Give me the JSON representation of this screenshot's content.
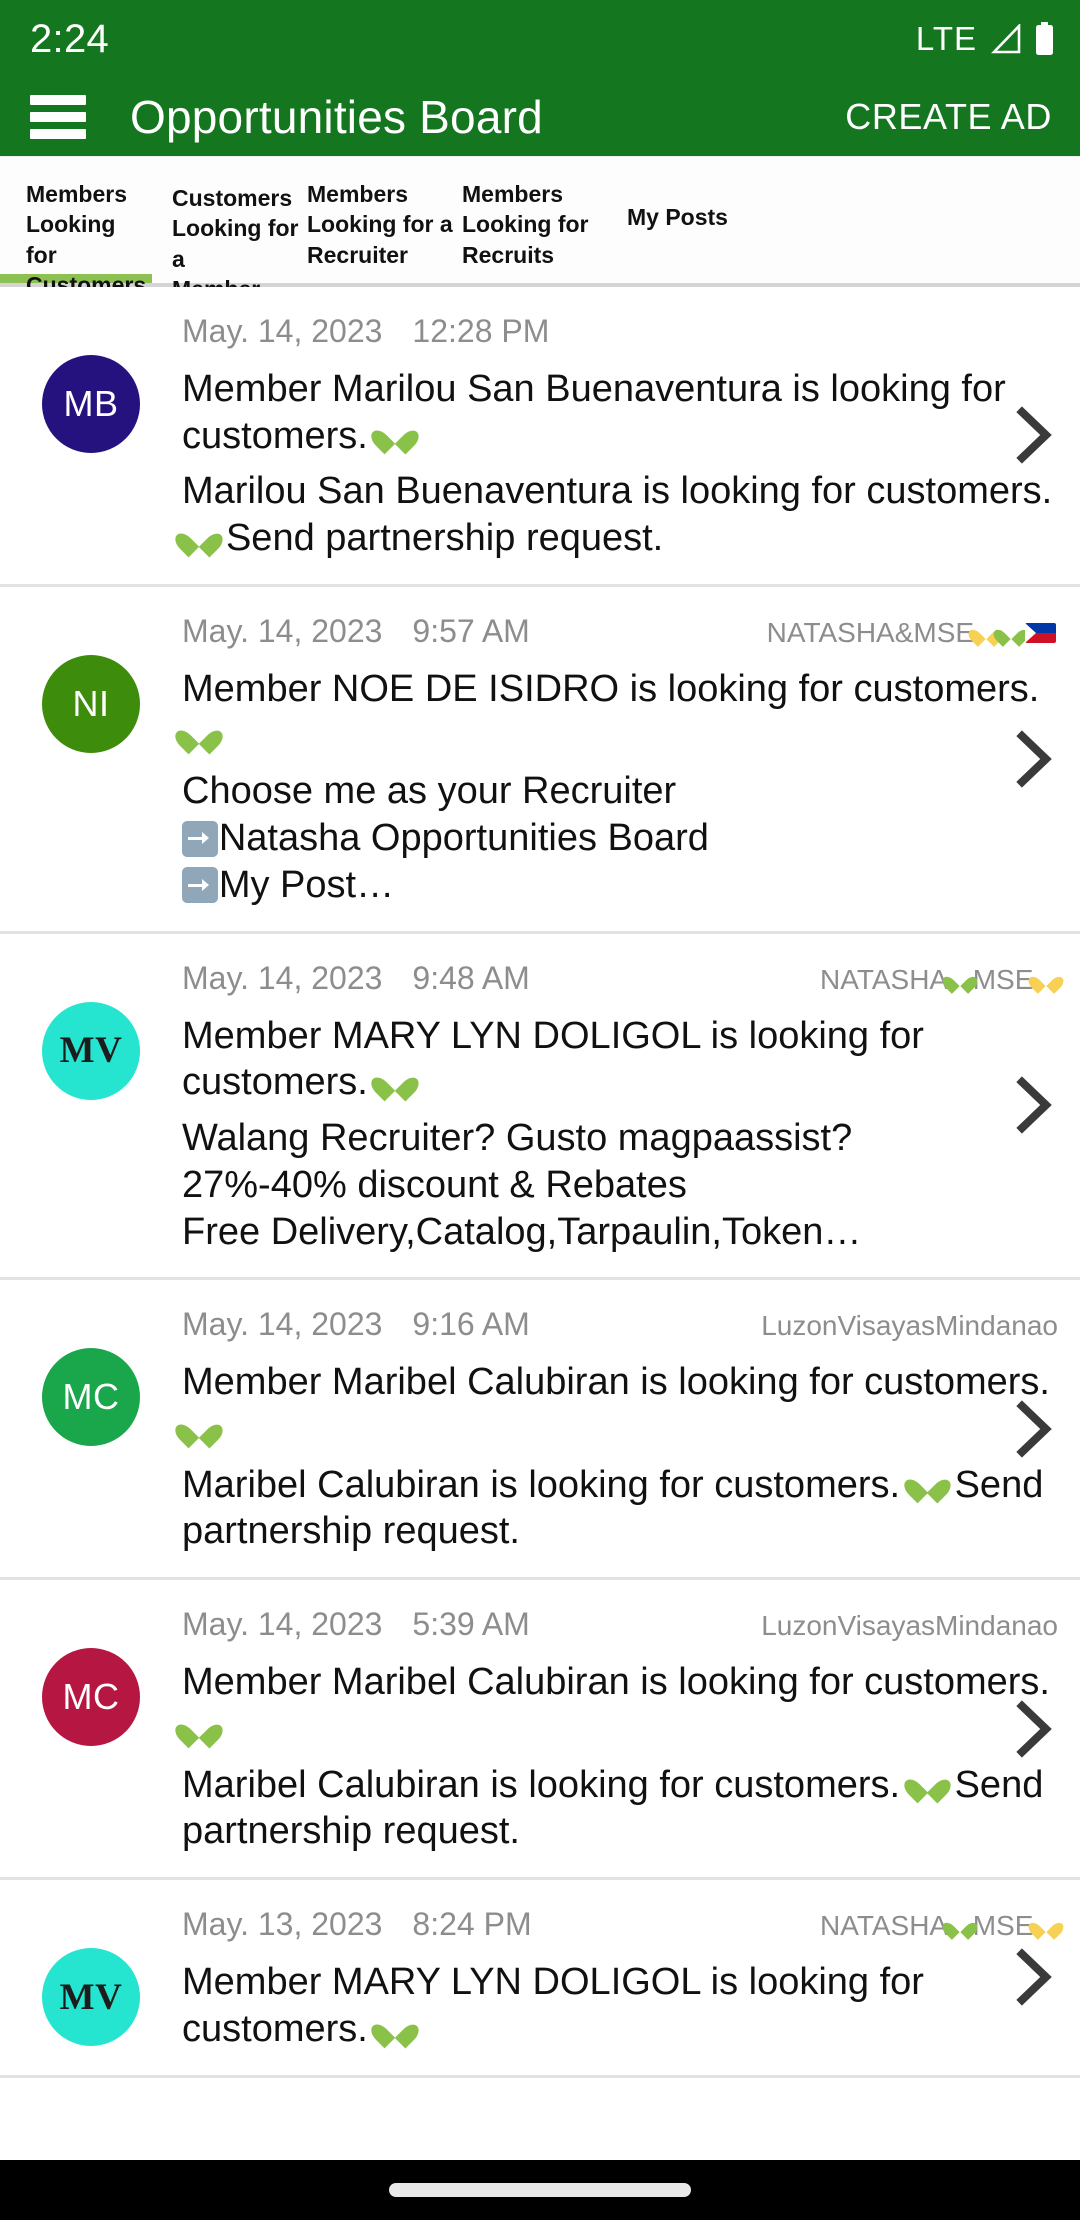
{
  "status_bar": {
    "time": "2:24",
    "network": "LTE",
    "signal_icon": "signal-triangle-icon",
    "battery_icon": "battery-full-icon"
  },
  "app_bar": {
    "menu_icon": "hamburger-menu-icon",
    "title": "Opportunities Board",
    "action_label": "CREATE AD",
    "background_color": "#14771f"
  },
  "tabs": {
    "active_index": 0,
    "indicator_color": "#8cc152",
    "items": [
      {
        "lines": [
          "Members",
          "Looking for",
          "Customers"
        ]
      },
      {
        "lines": [
          "Customers",
          "Looking for a",
          "Member"
        ]
      },
      {
        "lines": [
          "Members",
          "Looking for a",
          "Recruiter"
        ]
      },
      {
        "lines": [
          "Members",
          "Looking for",
          "Recruits"
        ]
      },
      {
        "lines": [
          "My Posts"
        ]
      }
    ]
  },
  "posts": [
    {
      "avatar_initials": "MB",
      "avatar_color": "#26127e",
      "avatar_font": "sans",
      "date": "May. 14, 2023",
      "time": "12:28 PM",
      "badge_text": "",
      "badge_emojis": [],
      "title_pre": "Member Marilou San Buenaventura is looking for customers. ",
      "title_heart": "green",
      "body_segments": [
        {
          "text": "Marilou San Buenaventura is looking for customers. "
        },
        {
          "heart": "green"
        },
        {
          "text": " Send partnership request."
        }
      ],
      "chevron_icon": "chevron-right-icon"
    },
    {
      "avatar_initials": "NI",
      "avatar_color": "#3d8c0c",
      "avatar_font": "sans",
      "date": "May. 14, 2023",
      "time": "9:57 AM",
      "badge_text": "NATASHA&MSE",
      "badge_emojis": [
        "yellow-heart",
        "green-heart",
        "philippines-flag"
      ],
      "title_pre": "Member NOE DE ISIDRO is looking for customers. ",
      "title_heart": "green",
      "body_segments": [
        {
          "text": "Choose me as your Recruiter\n"
        },
        {
          "arrow": true
        },
        {
          "text": "Natasha Opportunities Board\n"
        },
        {
          "arrow": true
        },
        {
          "text": "My Post…"
        }
      ],
      "chevron_icon": "chevron-right-icon"
    },
    {
      "avatar_initials": "MV",
      "avatar_color": "#25e4d0",
      "avatar_font": "serif",
      "date": "May. 14, 2023",
      "time": "9:48 AM",
      "badge_text": "NATASHA",
      "badge_text_2": "MSE",
      "badge_emojis": [
        "green-heart",
        "yellow-heart"
      ],
      "title_pre": "Member MARY LYN DOLIGOL is looking for customers. ",
      "title_heart": "green",
      "body_segments": [
        {
          "text": "Walang Recruiter? Gusto magpaassist?\n27%-40% discount & Rebates\nFree Delivery,Catalog,Tarpaulin,Token…"
        }
      ],
      "chevron_icon": "chevron-right-icon"
    },
    {
      "avatar_initials": "MC",
      "avatar_color": "#1aa64b",
      "avatar_font": "sans",
      "date": "May. 14, 2023",
      "time": "9:16 AM",
      "badge_text": "LuzonVisayasMindanao",
      "badge_emojis": [],
      "title_pre": "Member Maribel Calubiran is looking for customers. ",
      "title_heart": "green",
      "body_segments": [
        {
          "text": "Maribel Calubiran is looking for customers. "
        },
        {
          "heart": "green"
        },
        {
          "text": " Send partnership request."
        }
      ],
      "chevron_icon": "chevron-right-icon"
    },
    {
      "avatar_initials": "MC",
      "avatar_color": "#b51742",
      "avatar_font": "sans",
      "date": "May. 14, 2023",
      "time": "5:39 AM",
      "badge_text": "LuzonVisayasMindanao",
      "badge_emojis": [],
      "title_pre": "Member Maribel Calubiran is looking for customers. ",
      "title_heart": "green",
      "body_segments": [
        {
          "text": "Maribel Calubiran is looking for customers. "
        },
        {
          "heart": "green"
        },
        {
          "text": " Send partnership request."
        }
      ],
      "chevron_icon": "chevron-right-icon"
    },
    {
      "avatar_initials": "MV",
      "avatar_color": "#25e4d0",
      "avatar_font": "serif",
      "date": "May. 13, 2023",
      "time": "8:24 PM",
      "badge_text": "NATASHA",
      "badge_text_2": "MSE",
      "badge_emojis": [
        "green-heart",
        "yellow-heart"
      ],
      "title_pre": "Member MARY LYN DOLIGOL is looking for customers. ",
      "title_heart": "green",
      "body_segments": [],
      "chevron_icon": "chevron-right-icon"
    }
  ],
  "nav_bar": {
    "home_pill": "home-indicator-pill",
    "background_color": "#000000"
  },
  "colors": {
    "brand_green": "#14771f",
    "accent_green": "#8cc152",
    "meta_gray": "#8d8d8d",
    "divider": "#e2e2e2"
  }
}
